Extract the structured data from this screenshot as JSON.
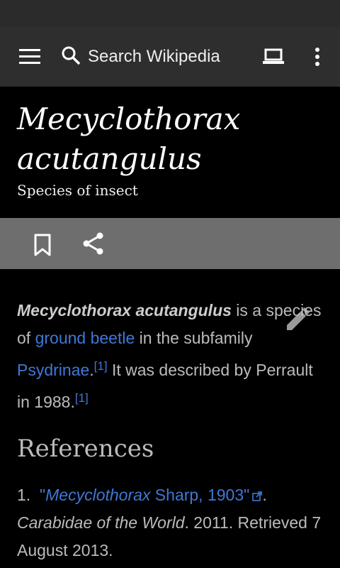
{
  "toolbar": {
    "search_placeholder": "Search Wikipedia"
  },
  "article": {
    "title_line1": "Mecyclothorax",
    "title_line2": "acutangulus",
    "description": "Species of insect",
    "lead": {
      "bold_name": "Mecyclothorax acutangulus",
      "t1": " is a species of ",
      "link1": "ground beetle",
      "t2": " in the subfamily ",
      "link2": "Psydrinae",
      "t3": ".",
      "ref1": "[1]",
      "t4": " It was described by Perrault in 1988.",
      "ref2": "[1]"
    }
  },
  "references": {
    "heading": "References",
    "items": [
      {
        "num": "1.",
        "link_open_quote": "\"",
        "link_italic": "Mecyclothorax",
        "link_rest": " Sharp, 1903\"",
        "after_link": ".",
        "work": "Carabidae of the World",
        "tail": ". 2011. Retrieved 7 August 2013."
      }
    ]
  },
  "colors": {
    "link": "#3e78d6",
    "toolbar_bg": "#2e2e2e",
    "actionbar_bg": "#6e6e6e"
  }
}
